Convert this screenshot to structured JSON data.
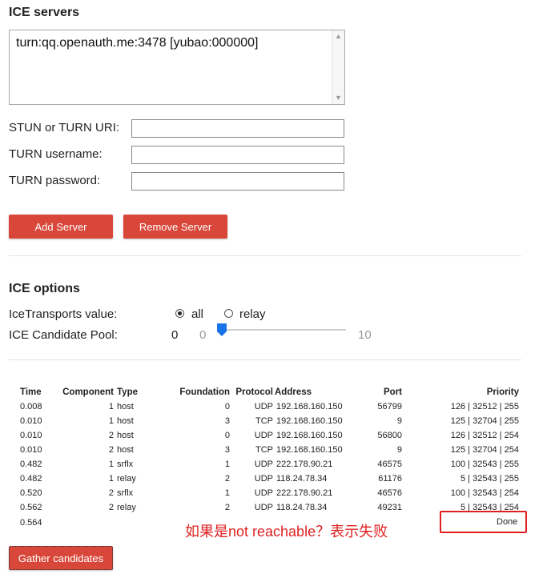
{
  "ice_servers": {
    "heading": "ICE servers",
    "servers": [
      "turn:qq.openauth.me:3478 [yubao:000000]"
    ],
    "stun_uri_label": "STUN or TURN URI:",
    "stun_uri_value": "",
    "turn_username_label": "TURN username:",
    "turn_username_value": "",
    "turn_password_label": "TURN password:",
    "turn_password_value": "",
    "add_button": "Add Server",
    "remove_button": "Remove Server"
  },
  "ice_options": {
    "heading": "ICE options",
    "transports_label": "IceTransports value:",
    "transport_all": "all",
    "transport_relay": "relay",
    "selected_transport": "all",
    "pool_label": "ICE Candidate Pool:",
    "pool_value": "0",
    "pool_min": "0",
    "pool_max": "10"
  },
  "candidates": {
    "columns": [
      "Time",
      "Component",
      "Type",
      "Foundation",
      "Protocol",
      "Address",
      "Port",
      "Priority"
    ],
    "rows": [
      {
        "time": "0.008",
        "component": "1",
        "type": "host",
        "foundation": "0",
        "protocol": "UDP",
        "address": "192.168.160.150",
        "port": "56799",
        "priority": "126 | 32512 | 255"
      },
      {
        "time": "0.010",
        "component": "1",
        "type": "host",
        "foundation": "3",
        "protocol": "TCP",
        "address": "192.168.160.150",
        "port": "9",
        "priority": "125 | 32704 | 255"
      },
      {
        "time": "0.010",
        "component": "2",
        "type": "host",
        "foundation": "0",
        "protocol": "UDP",
        "address": "192.168.160.150",
        "port": "56800",
        "priority": "126 | 32512 | 254"
      },
      {
        "time": "0.010",
        "component": "2",
        "type": "host",
        "foundation": "3",
        "protocol": "TCP",
        "address": "192.168.160.150",
        "port": "9",
        "priority": "125 | 32704 | 254"
      },
      {
        "time": "0.482",
        "component": "1",
        "type": "srflx",
        "foundation": "1",
        "protocol": "UDP",
        "address": "222.178.90.21",
        "port": "46575",
        "priority": "100 | 32543 | 255"
      },
      {
        "time": "0.482",
        "component": "1",
        "type": "relay",
        "foundation": "2",
        "protocol": "UDP",
        "address": "118.24.78.34",
        "port": "61176",
        "priority": "5 | 32543 | 255"
      },
      {
        "time": "0.520",
        "component": "2",
        "type": "srflx",
        "foundation": "1",
        "protocol": "UDP",
        "address": "222.178.90.21",
        "port": "46576",
        "priority": "100 | 32543 | 254"
      },
      {
        "time": "0.562",
        "component": "2",
        "type": "relay",
        "foundation": "2",
        "protocol": "UDP",
        "address": "118.24.78.34",
        "port": "49231",
        "priority": "5 | 32543 | 254"
      }
    ],
    "final_time": "0.564",
    "final_status": "Done",
    "gather_button": "Gather candidates"
  },
  "annotation": {
    "text": "如果是not reachable？表示失败",
    "color": "#e02020"
  },
  "colors": {
    "button": "#d9473a",
    "slider": "#1a73e8"
  },
  "icons": {
    "scroll_up": "scroll-up-arrow-icon",
    "scroll_down": "scroll-down-arrow-icon",
    "slider_thumb": "slider-thumb-icon"
  }
}
